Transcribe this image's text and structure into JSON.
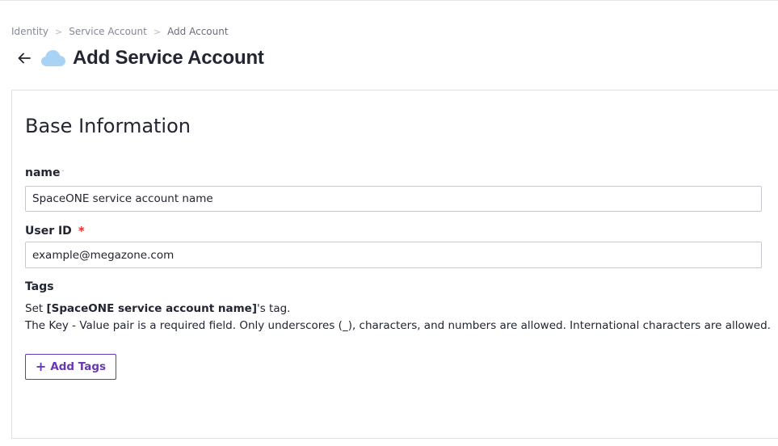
{
  "breadcrumb": {
    "items": [
      "Identity",
      "Service Account",
      "Add Account"
    ],
    "separator": ">"
  },
  "header": {
    "back_icon": "arrow-left-icon",
    "provider_icon": "cloud-icon",
    "title": "Add Service Account"
  },
  "form": {
    "section_title": "Base Information",
    "name": {
      "label": "name",
      "required_marker": "·",
      "placeholder": "SpaceONE service account name",
      "value": ""
    },
    "user_id": {
      "label": "User ID",
      "required_marker": "*",
      "placeholder": "example@megazone.com",
      "value": ""
    },
    "tags": {
      "label": "Tags",
      "desc_prefix": "Set ",
      "desc_bold": "[SpaceONE service account name]",
      "desc_suffix": "'s tag.",
      "desc_line2": "The Key - Value pair is a required field. Only underscores (_), characters, and numbers are allowed. International characters are allowed.",
      "add_button_label": "Add Tags",
      "add_button_icon": "plus-icon"
    }
  },
  "colors": {
    "primary": "#6638b6",
    "required": "#e2352d",
    "cloud": "#a9d3f5",
    "text": "#222532",
    "muted": "#858895"
  }
}
